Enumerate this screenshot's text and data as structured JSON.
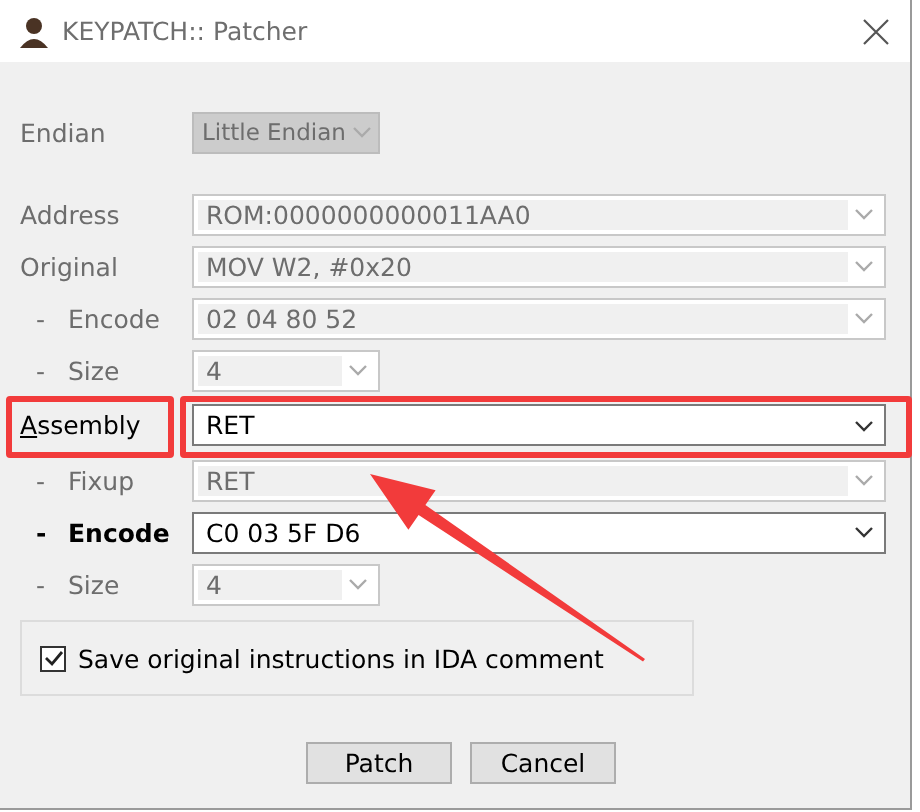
{
  "window": {
    "title": "KEYPATCH:: Patcher"
  },
  "endian": {
    "label": "Endian",
    "value": "Little Endian",
    "disabled": true
  },
  "fields": [
    {
      "kind": "combo",
      "label": "Address",
      "value": "ROM:0000000000011AA0",
      "disabled": true
    },
    {
      "kind": "combo",
      "label": "Original",
      "value": "MOV W2, #0x20",
      "disabled": true
    },
    {
      "kind": "combo",
      "prefix": "-",
      "label": "Encode",
      "value": "02 04 80 52",
      "disabled": true
    },
    {
      "kind": "size",
      "prefix": "-",
      "label": "Size",
      "value": "4",
      "disabled": true
    },
    {
      "kind": "combo",
      "label": "Assembly",
      "value": "RET",
      "disabled": false,
      "mnemonic": true,
      "highlighted": true
    },
    {
      "kind": "combo",
      "prefix": "-",
      "label": "Fixup",
      "value": "RET",
      "disabled": true
    },
    {
      "kind": "combo",
      "prefix": "-",
      "label": "Encode",
      "value": "C0 03 5F D6",
      "disabled": false,
      "bold": true
    },
    {
      "kind": "size",
      "prefix": "-",
      "label": "Size",
      "value": "4",
      "disabled": true
    }
  ],
  "option": {
    "label": "Save original instructions in IDA comment",
    "checked": true
  },
  "buttons": [
    "Patch",
    "Cancel"
  ]
}
